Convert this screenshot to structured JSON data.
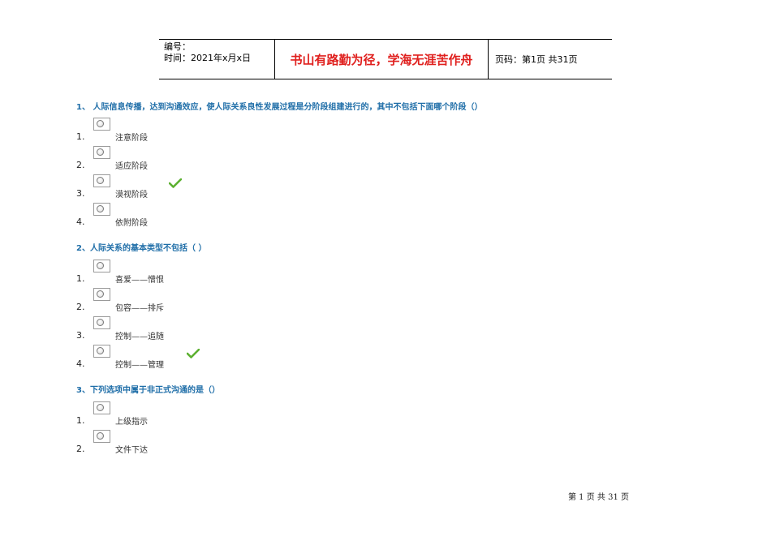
{
  "header": {
    "number_label": "编号：",
    "time_text": "时间：2021年x月x日",
    "motto": "书山有路勤为径，学海无涯苦作舟",
    "page_text": "页码：第1页  共31页"
  },
  "questions": [
    {
      "title": "1、  人际信息传播，达到沟通效应，使人际关系良性发展过程是分阶段组建进行的，其中不包括下面哪个阶段（）",
      "options": [
        {
          "num": "1.",
          "text": "注意阶段"
        },
        {
          "num": "2.",
          "text": "适应阶段"
        },
        {
          "num": "3.",
          "text": "漠视阶段",
          "correct": true
        },
        {
          "num": "4.",
          "text": "依附阶段"
        }
      ]
    },
    {
      "title": "2、人际关系的基本类型不包括（  ）",
      "options": [
        {
          "num": "1.",
          "text": "喜爱——憎恨"
        },
        {
          "num": "2.",
          "text": "包容——排斥"
        },
        {
          "num": "3.",
          "text": "控制——追随"
        },
        {
          "num": "4.",
          "text": "控制——管理",
          "correct": true
        }
      ]
    },
    {
      "title": "3、下列选项中属于非正式沟通的是（）",
      "options": [
        {
          "num": "1.",
          "text": "上级指示"
        },
        {
          "num": "2.",
          "text": "文件下达"
        }
      ]
    }
  ],
  "footer": {
    "page_text": "第 1 页 共 31 页"
  },
  "colors": {
    "question": "#1f6ea8",
    "motto": "#e0201e",
    "check": "#5cb030"
  }
}
